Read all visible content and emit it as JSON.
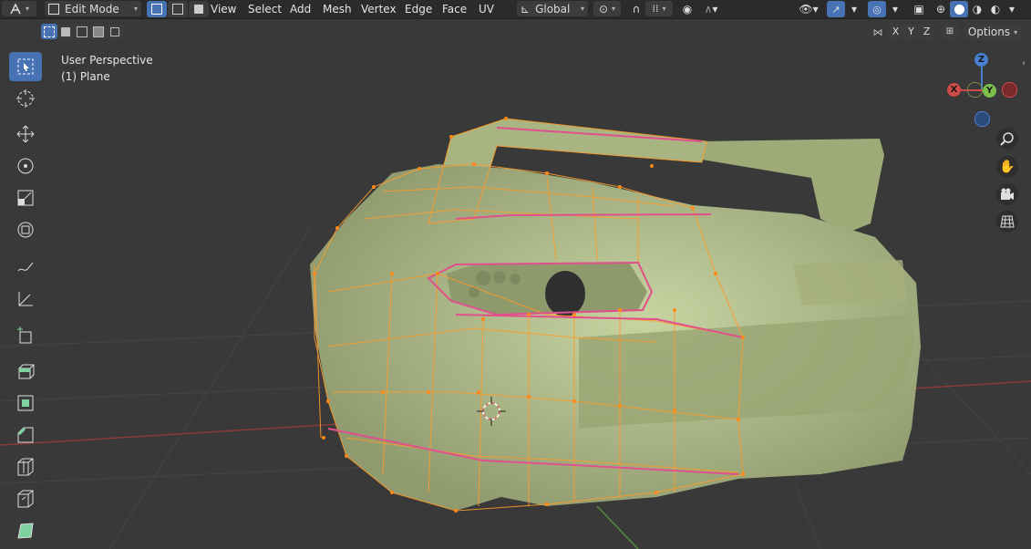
{
  "header": {
    "mode_label": "Edit Mode",
    "menus": [
      "View",
      "Select",
      "Add",
      "Mesh",
      "Vertex",
      "Edge",
      "Face",
      "UV"
    ],
    "transform_orientation": "Global",
    "options_label": "Options",
    "axis_labels": [
      "X",
      "Y",
      "Z"
    ]
  },
  "viewport": {
    "view_name": "User Perspective",
    "object_name": "(1) Plane"
  },
  "gizmo": {
    "x": "X",
    "y": "Y",
    "z": "Z"
  },
  "toolbar": {
    "tools": [
      "select-box",
      "cursor",
      "move",
      "rotate",
      "scale",
      "transform",
      "annotate",
      "measure",
      "add-cube",
      "extrude-region",
      "inset-faces",
      "bevel",
      "loop-cut",
      "knife",
      "poly-build"
    ]
  },
  "colors": {
    "accent": "#4772b3",
    "bg": "#393939",
    "header": "#2b2b2b",
    "mesh": "#b7c494",
    "selected_edge": "#ff9a2a",
    "seam": "#e0508c"
  }
}
